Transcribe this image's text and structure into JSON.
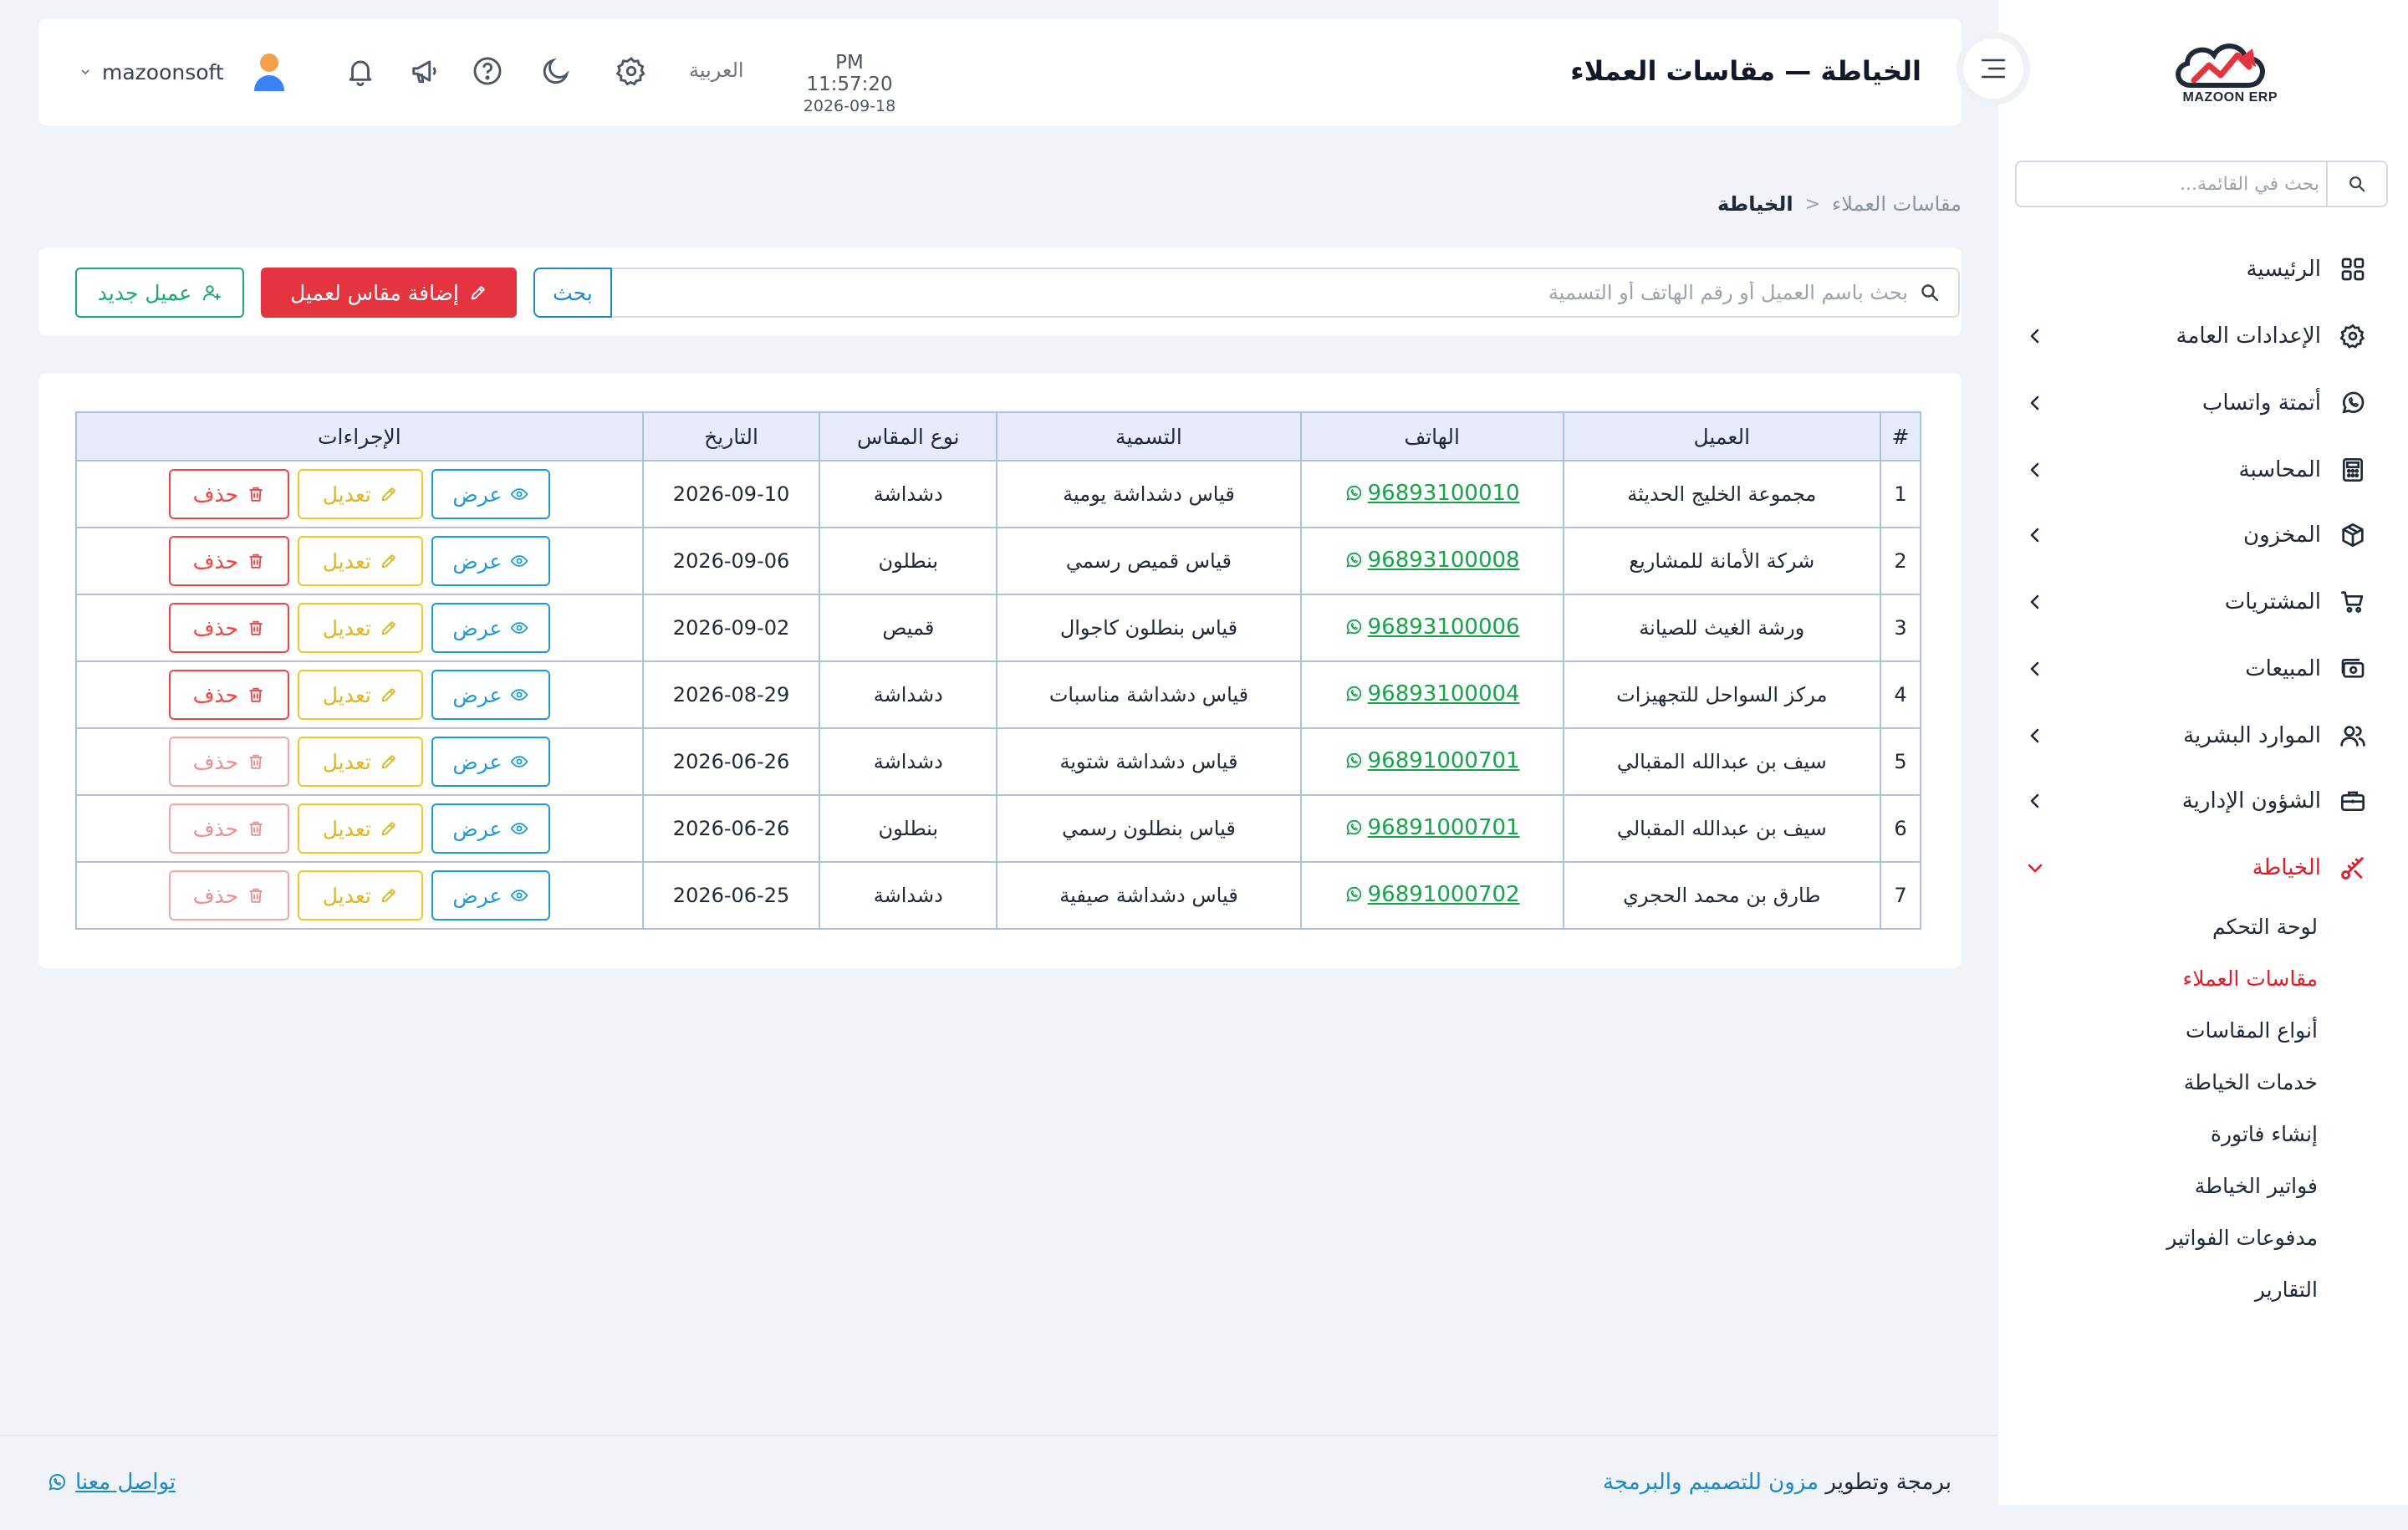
{
  "app": {
    "brand": "MAZOON ERP",
    "brand_sub": "ERP"
  },
  "header": {
    "page_title": "الخياطة — مقاسات العملاء",
    "time": "PM 11:57:20",
    "date": "2026-09-18",
    "language": "العربية",
    "username": "mazoonsoft",
    "icons": [
      "gear-icon",
      "moon-icon",
      "help-icon",
      "megaphone-icon",
      "bell-icon"
    ]
  },
  "sidebar": {
    "search_placeholder": "بحث في القائمة...",
    "items": [
      {
        "label": "الرئيسية",
        "icon": "grid-icon"
      },
      {
        "label": "الإعدادات العامة",
        "icon": "gear-icon"
      },
      {
        "label": "أتمتة واتساب",
        "icon": "whatsapp-icon"
      },
      {
        "label": "المحاسبة",
        "icon": "calculator-icon"
      },
      {
        "label": "المخزون",
        "icon": "box-icon"
      },
      {
        "label": "المشتريات",
        "icon": "cart-icon"
      },
      {
        "label": "المبيعات",
        "icon": "cash-icon"
      },
      {
        "label": "الموارد البشرية",
        "icon": "users-icon"
      },
      {
        "label": "الشؤون الإدارية",
        "icon": "briefcase-icon"
      },
      {
        "label": "الخياطة",
        "icon": "scissors-icon"
      }
    ],
    "sub_items": [
      {
        "label": "لوحة التحكم"
      },
      {
        "label": "مقاسات العملاء"
      },
      {
        "label": "أنواع المقاسات"
      },
      {
        "label": "خدمات الخياطة"
      },
      {
        "label": "إنشاء فاتورة"
      },
      {
        "label": "فواتير الخياطة"
      },
      {
        "label": "مدفوعات الفواتير"
      },
      {
        "label": "التقارير"
      }
    ],
    "active_color": "#e11d2c"
  },
  "breadcrumb": {
    "root": "الخياطة",
    "separator": "<",
    "current": "مقاسات العملاء"
  },
  "toolbar": {
    "search_placeholder": "بحث باسم العميل أو رقم الهاتف أو التسمية",
    "search_button": "بحث",
    "add_measure_button": "إضافة مقاس لعميل",
    "new_client_button": "عميل جديد"
  },
  "table": {
    "headers": {
      "index": "#",
      "client": "العميل",
      "phone": "الهاتف",
      "name": "التسمية",
      "type": "نوع المقاس",
      "date": "التاريخ",
      "actions": "الإجراءات"
    },
    "action_labels": {
      "view": "عرض",
      "edit": "تعديل",
      "delete": "حذف"
    },
    "rows": [
      {
        "index": "1",
        "client": "مجموعة الخليج الحديثة",
        "phone": "96893100010",
        "name": "قياس دشداشة يومية",
        "type": "دشداشة",
        "date": "2026-09-10"
      },
      {
        "index": "2",
        "client": "شركة الأمانة للمشاريع",
        "phone": "96893100008",
        "name": "قياس قميص رسمي",
        "type": "بنطلون",
        "date": "2026-09-06"
      },
      {
        "index": "3",
        "client": "ورشة الغيث للصيانة",
        "phone": "96893100006",
        "name": "قياس بنطلون كاجوال",
        "type": "قميص",
        "date": "2026-09-02"
      },
      {
        "index": "4",
        "client": "مركز السواحل للتجهيزات",
        "phone": "96893100004",
        "name": "قياس دشداشة مناسبات",
        "type": "دشداشة",
        "date": "2026-08-29"
      },
      {
        "index": "5",
        "client": "سيف بن عبدالله المقبالي",
        "phone": "96891000701",
        "name": "قياس دشداشة شتوية",
        "type": "دشداشة",
        "date": "2026-06-26"
      },
      {
        "index": "6",
        "client": "سيف بن عبدالله المقبالي",
        "phone": "96891000701",
        "name": "قياس بنطلون رسمي",
        "type": "بنطلون",
        "date": "2026-06-26"
      },
      {
        "index": "7",
        "client": "طارق بن محمد الحجري",
        "phone": "96891000702",
        "name": "قياس دشداشة صيفية",
        "type": "دشداشة",
        "date": "2026-06-25"
      }
    ]
  },
  "footer": {
    "credit_prefix": "برمجة وتطوير",
    "credit_link": "مزون للتصميم والبرمجة",
    "contact": "تواصل معنا"
  },
  "colors": {
    "primary": "#1e88c8",
    "danger": "#e3343f",
    "success": "#1fa971",
    "warning": "#f5c32c",
    "phone": "#16a34a"
  }
}
